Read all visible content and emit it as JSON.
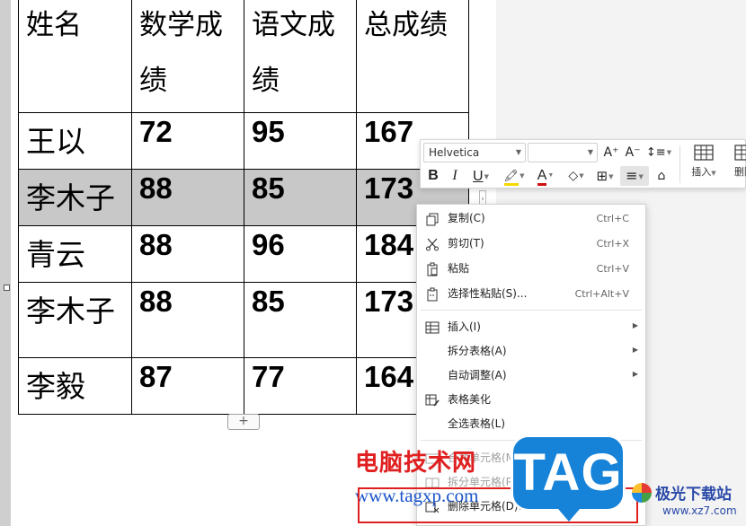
{
  "table": {
    "headers": [
      "姓名",
      "数学成绩",
      "语文成绩",
      "总成绩"
    ],
    "rows": [
      {
        "name": "王以",
        "math": "72",
        "chinese": "95",
        "total": "167"
      },
      {
        "name": "李木子",
        "math": "88",
        "chinese": "85",
        "total": "173"
      },
      {
        "name": "青云",
        "math": "88",
        "chinese": "96",
        "total": "184"
      },
      {
        "name": "李木子",
        "math": "88",
        "chinese": "85",
        "total": "173"
      },
      {
        "name": "李毅",
        "math": "87",
        "chinese": "77",
        "total": "164"
      }
    ],
    "selected_row_index": 1
  },
  "add_row_label": "+",
  "toolbar": {
    "font_name": "Helvetica",
    "font_size": "",
    "grow_font": "A⁺",
    "shrink_font": "A⁻",
    "line_spacing": "↕≡",
    "bold": "B",
    "italic": "I",
    "underline": "U",
    "highlight": "🖍",
    "font_color": "A",
    "shading": "◇",
    "borders": "⊞",
    "align": "≡",
    "format_painter": "⌂",
    "insert_label": "插入",
    "delete_label": "删除",
    "colors": {
      "highlight": "#f5d800",
      "font_color": "#d01010"
    }
  },
  "menu": {
    "copy": {
      "label": "复制(C)",
      "shortcut": "Ctrl+C",
      "icon": "copy-icon"
    },
    "cut": {
      "label": "剪切(T)",
      "shortcut": "Ctrl+X",
      "icon": "scissors-icon"
    },
    "paste": {
      "label": "粘贴",
      "shortcut": "Ctrl+V",
      "icon": "clipboard-icon"
    },
    "paste_special": {
      "label": "选择性粘贴(S)...",
      "shortcut": "Ctrl+Alt+V",
      "icon": "paste-special-icon"
    },
    "insert": {
      "label": "插入(I)",
      "icon": "table-insert-icon"
    },
    "split_table": {
      "label": "拆分表格(A)"
    },
    "auto_fit": {
      "label": "自动调整(A)"
    },
    "beautify": {
      "label": "表格美化",
      "icon": "table-style-icon"
    },
    "select_table": {
      "label": "全选表格(L)"
    },
    "merge_cells": {
      "label": "合并单元格(M)",
      "icon": "merge-cells-icon"
    },
    "split_cells": {
      "label": "拆分单元格(P)...",
      "icon": "split-cells-icon"
    },
    "delete_cells": {
      "label": "删除单元格(D)...",
      "icon": "delete-cells-icon"
    }
  },
  "watermark": {
    "site_name": "电脑技术网",
    "url": "www.tagxp.com",
    "tag": "TAG",
    "site2_name": "极光下载站",
    "site2_url": "www.xz7.com",
    "colors": {
      "red": "#e02020",
      "blue": "#1683d8"
    }
  }
}
